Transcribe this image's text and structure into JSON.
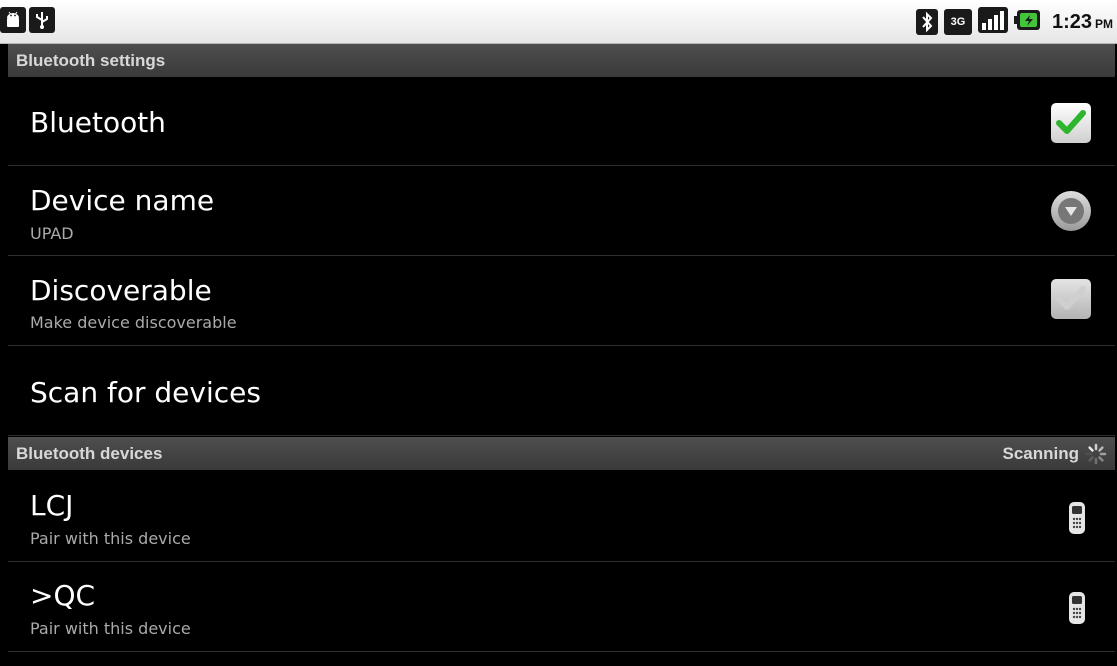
{
  "status_bar": {
    "left_icons": [
      "android-debug-icon",
      "usb-icon"
    ],
    "right_icons": [
      "bluetooth-icon",
      "3g-data-icon",
      "signal-icon",
      "battery-icon"
    ],
    "time": "1:23",
    "ampm": "PM"
  },
  "page": {
    "title": "Bluetooth settings"
  },
  "settings": {
    "bluetooth": {
      "title": "Bluetooth",
      "checked": true
    },
    "device_name": {
      "title": "Device name",
      "value": "UPAD"
    },
    "discoverable": {
      "title": "Discoverable",
      "summary": "Make device discoverable",
      "checked": true,
      "enabled": false
    },
    "scan": {
      "title": "Scan for devices"
    }
  },
  "devices_section": {
    "title": "Bluetooth devices",
    "status": "Scanning"
  },
  "devices": [
    {
      "name": "LCJ",
      "summary": "Pair with this device",
      "icon": "phone-icon"
    },
    {
      "name": ">QC",
      "summary": "Pair with this device",
      "icon": "phone-icon"
    }
  ],
  "colors": {
    "accent_check": "#2db52d",
    "header_bg": "#444444",
    "background": "#000000"
  }
}
